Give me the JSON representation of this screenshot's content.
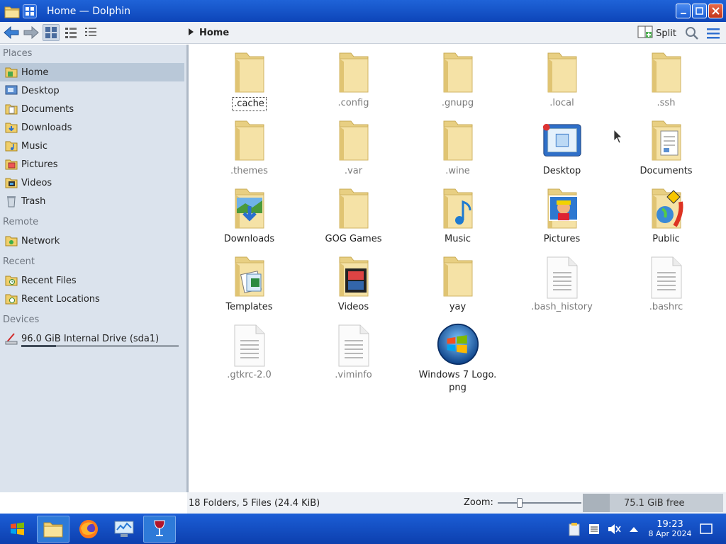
{
  "window": {
    "title": "Home — Dolphin"
  },
  "toolbar": {
    "breadcrumb_current": "Home",
    "split_label": "Split"
  },
  "sidebar": {
    "sections": {
      "places": "Places",
      "remote": "Remote",
      "recent": "Recent",
      "devices": "Devices"
    },
    "places": [
      {
        "label": "Home",
        "icon": "home-folder-icon",
        "active": true
      },
      {
        "label": "Desktop",
        "icon": "desktop-icon"
      },
      {
        "label": "Documents",
        "icon": "documents-folder-icon"
      },
      {
        "label": "Downloads",
        "icon": "downloads-folder-icon"
      },
      {
        "label": "Music",
        "icon": "music-folder-icon"
      },
      {
        "label": "Pictures",
        "icon": "pictures-folder-icon"
      },
      {
        "label": "Videos",
        "icon": "videos-folder-icon"
      },
      {
        "label": "Trash",
        "icon": "trash-icon"
      }
    ],
    "remote": [
      {
        "label": "Network",
        "icon": "network-icon"
      }
    ],
    "recent": [
      {
        "label": "Recent Files",
        "icon": "recent-files-icon"
      },
      {
        "label": "Recent Locations",
        "icon": "recent-locations-icon"
      }
    ],
    "devices": [
      {
        "label": "96.0 GiB Internal Drive (sda1)",
        "icon": "drive-icon",
        "usage_fraction": 0.22
      }
    ]
  },
  "files": [
    {
      "name": ".cache",
      "kind": "folder",
      "hidden": false,
      "focused": true
    },
    {
      "name": ".config",
      "kind": "folder",
      "hidden": true
    },
    {
      "name": ".gnupg",
      "kind": "folder",
      "hidden": true
    },
    {
      "name": ".local",
      "kind": "folder",
      "hidden": true
    },
    {
      "name": ".ssh",
      "kind": "folder",
      "hidden": true
    },
    {
      "name": ".themes",
      "kind": "folder",
      "hidden": true
    },
    {
      "name": ".var",
      "kind": "folder",
      "hidden": true
    },
    {
      "name": ".wine",
      "kind": "folder",
      "hidden": true
    },
    {
      "name": "Desktop",
      "kind": "desktop"
    },
    {
      "name": "Documents",
      "kind": "documents"
    },
    {
      "name": "Downloads",
      "kind": "downloads"
    },
    {
      "name": "GOG Games",
      "kind": "folder"
    },
    {
      "name": "Music",
      "kind": "music"
    },
    {
      "name": "Pictures",
      "kind": "pictures"
    },
    {
      "name": "Public",
      "kind": "public"
    },
    {
      "name": "Templates",
      "kind": "templates"
    },
    {
      "name": "Videos",
      "kind": "videos"
    },
    {
      "name": "yay",
      "kind": "folder"
    },
    {
      "name": ".bash_history",
      "kind": "file",
      "hidden": true
    },
    {
      "name": ".bashrc",
      "kind": "file",
      "hidden": true
    },
    {
      "name": ".gtkrc-2.0",
      "kind": "file",
      "hidden": true
    },
    {
      "name": ".viminfo",
      "kind": "file",
      "hidden": true
    },
    {
      "name": "Windows 7 Logo.\npng",
      "kind": "image"
    }
  ],
  "statusbar": {
    "summary": "18 Folders, 5 Files (24.4 KiB)",
    "zoom_label": "Zoom:",
    "zoom_fraction": 0.25,
    "free_space": "75.1 GiB free"
  },
  "taskbar": {
    "time": "19:23",
    "date": "8 Apr 2024"
  },
  "colors": {
    "titlebar": "#1a57cf",
    "sidebar": "#dbe3ed",
    "selection": "#b9c8d8",
    "folder": "#f3dc8e"
  }
}
